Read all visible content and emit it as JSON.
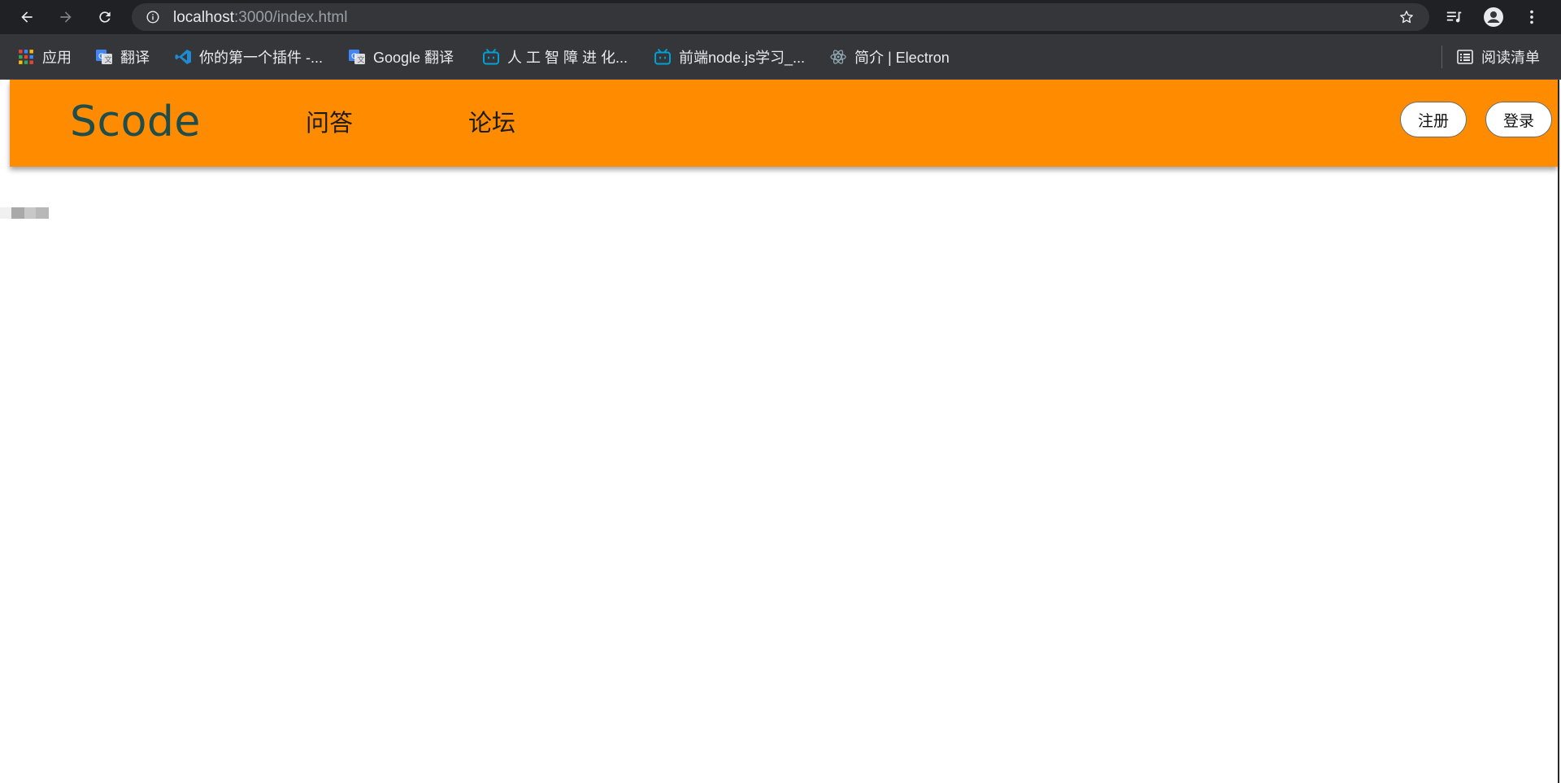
{
  "browser": {
    "url_host": "localhost",
    "url_rest": ":3000/index.html",
    "bookmarks": [
      {
        "label": "应用",
        "icon": "apps-grid-icon"
      },
      {
        "label": "翻译",
        "icon": "google-translate-icon"
      },
      {
        "label": "你的第一个插件 -...",
        "icon": "vscode-icon"
      },
      {
        "label": "Google 翻译",
        "icon": "google-translate-icon"
      },
      {
        "label": "人 工 智 障 进 化...",
        "icon": "bilibili-icon"
      },
      {
        "label": "前端node.js学习_...",
        "icon": "bilibili-icon"
      },
      {
        "label": "简介 | Electron",
        "icon": "electron-icon"
      }
    ],
    "reading_list": "阅读清单"
  },
  "site": {
    "logo": "Scode",
    "nav": [
      {
        "label": "问答"
      },
      {
        "label": "论坛"
      }
    ],
    "register_label": "注册",
    "login_label": "登录"
  },
  "colors": {
    "header_bg": "#ff8c00",
    "logo_color": "#1e4d4b",
    "chrome_dark": "#202124",
    "bookmark_bar": "#35363a"
  }
}
